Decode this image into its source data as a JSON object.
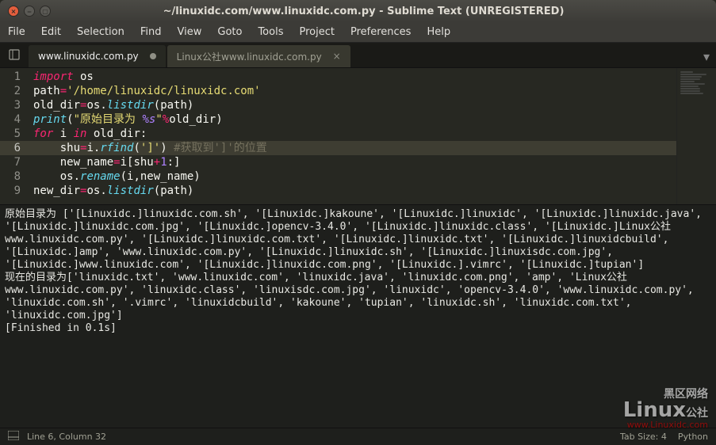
{
  "window": {
    "title": "~/linuxidc.com/www.linuxidc.com.py - Sublime Text (UNREGISTERED)"
  },
  "menu": [
    "File",
    "Edit",
    "Selection",
    "Find",
    "View",
    "Goto",
    "Tools",
    "Project",
    "Preferences",
    "Help"
  ],
  "tabs": [
    {
      "label": "www.linuxidc.com.py",
      "active": true,
      "dirty": true
    },
    {
      "label": "Linux公社www.linuxidc.com.py",
      "active": false,
      "dirty": false
    }
  ],
  "code": {
    "lines": [
      {
        "n": 1,
        "seg": [
          [
            "kw",
            "import"
          ],
          [
            "var",
            " os"
          ]
        ]
      },
      {
        "n": 2,
        "seg": [
          [
            "var",
            "path"
          ],
          [
            "op",
            "="
          ],
          [
            "str",
            "'/home/linuxidc/linuxidc.com'"
          ]
        ]
      },
      {
        "n": 3,
        "seg": [
          [
            "var",
            "old_dir"
          ],
          [
            "op",
            "="
          ],
          [
            "var",
            "os"
          ],
          [
            "var",
            "."
          ],
          [
            "fn",
            "listdir"
          ],
          [
            "var",
            "(path)"
          ]
        ]
      },
      {
        "n": 4,
        "seg": [
          [
            "fn",
            "print"
          ],
          [
            "var",
            "("
          ],
          [
            "str",
            "\"原始目录为 "
          ],
          [
            "cst",
            "%s"
          ],
          [
            "str",
            "\""
          ],
          [
            "op",
            "%"
          ],
          [
            "var",
            "old_dir)"
          ]
        ]
      },
      {
        "n": 5,
        "seg": [
          [
            "kw",
            "for"
          ],
          [
            "var",
            " i "
          ],
          [
            "kw",
            "in"
          ],
          [
            "var",
            " old_dir:"
          ]
        ]
      },
      {
        "n": 6,
        "hl": true,
        "seg": [
          [
            "var",
            "    shu"
          ],
          [
            "op",
            "="
          ],
          [
            "var",
            "i"
          ],
          [
            "var",
            "."
          ],
          [
            "fn",
            "rfind"
          ],
          [
            "var",
            "("
          ],
          [
            "str",
            "']'"
          ],
          [
            "var",
            ") "
          ],
          [
            "cmt",
            "#获取到']'的位置"
          ]
        ]
      },
      {
        "n": 7,
        "seg": [
          [
            "var",
            "    new_name"
          ],
          [
            "op",
            "="
          ],
          [
            "var",
            "i[shu"
          ],
          [
            "op",
            "+"
          ],
          [
            "num",
            "1"
          ],
          [
            "var",
            ":]"
          ]
        ]
      },
      {
        "n": 8,
        "seg": [
          [
            "var",
            "    os"
          ],
          [
            "var",
            "."
          ],
          [
            "fn",
            "rename"
          ],
          [
            "var",
            "(i,new_name)"
          ]
        ]
      },
      {
        "n": 9,
        "seg": [
          [
            "var",
            "new_dir"
          ],
          [
            "op",
            "="
          ],
          [
            "var",
            "os"
          ],
          [
            "var",
            "."
          ],
          [
            "fn",
            "listdir"
          ],
          [
            "var",
            "(path)"
          ]
        ]
      }
    ]
  },
  "output": "原始目录为 ['[Linuxidc.]linuxidc.com.sh', '[Linuxidc.]kakoune', '[Linuxidc.]linuxidc', '[Linuxidc.]linuxidc.java', '[Linuxidc.]linuxidc.com.jpg', '[Linuxidc.]opencv-3.4.0', '[Linuxidc.]linuxidc.class', '[Linuxidc.]Linux公社www.linuxidc.com.py', '[Linuxidc.]linuxidc.com.txt', '[Linuxidc.]linuxidc.txt', '[Linuxidc.]linuxidcbuild', '[Linuxidc.]amp', 'www.linuxidc.com.py', '[Linuxidc.]linuxidc.sh', '[Linuxidc.]linuxisdc.com.jpg', '[Linuxidc.]www.linuxidc.com', '[Linuxidc.]linuxidc.com.png', '[Linuxidc.].vimrc', '[Linuxidc.]tupian']\n现在的目录为['linuxidc.txt', 'www.linuxidc.com', 'linuxidc.java', 'linuxidc.com.png', 'amp', 'Linux公社www.linuxidc.com.py', 'linuxidc.class', 'linuxisdc.com.jpg', 'linuxidc', 'opencv-3.4.0', 'www.linuxidc.com.py', 'linuxidc.com.sh', '.vimrc', 'linuxidcbuild', 'kakoune', 'tupian', 'linuxidc.sh', 'linuxidc.com.txt', 'linuxidc.com.jpg']\n[Finished in 0.1s]",
  "status": {
    "cursor": "Line 6, Column 32",
    "spaces": "Tab Size: 4",
    "syntax": "Python"
  },
  "watermark": {
    "text1": "黑区网络",
    "text2": "Linux",
    "text3": "公社",
    "url": "www.Linuxidc.com"
  }
}
